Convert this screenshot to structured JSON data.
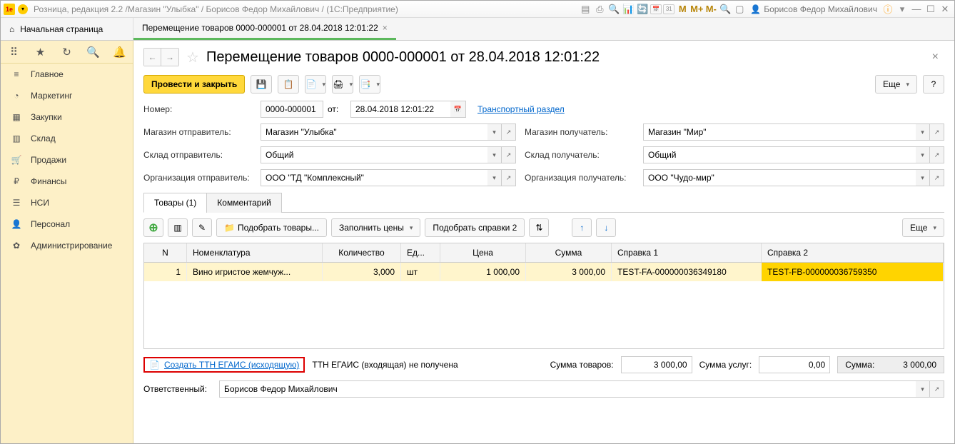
{
  "titlebar": {
    "title": "Розница, редакция 2.2 /Магазин \"Улыбка\" / Борисов Федор Михайлович / (1С:Предприятие)",
    "user": "Борисов Федор Михайлович"
  },
  "tabs": {
    "home": "Начальная страница",
    "doc": "Перемещение товаров 0000-000001 от 28.04.2018 12:01:22"
  },
  "sidebar": {
    "items": [
      {
        "label": "Главное",
        "icon": "≡"
      },
      {
        "label": "Маркетинг",
        "icon": "◔"
      },
      {
        "label": "Закупки",
        "icon": "▦"
      },
      {
        "label": "Склад",
        "icon": "▥"
      },
      {
        "label": "Продажи",
        "icon": "🛒"
      },
      {
        "label": "Финансы",
        "icon": "₽"
      },
      {
        "label": "НСИ",
        "icon": "☰"
      },
      {
        "label": "Персонал",
        "icon": "👤"
      },
      {
        "label": "Администрирование",
        "icon": "✿"
      }
    ]
  },
  "doc": {
    "title": "Перемещение товаров 0000-000001 от 28.04.2018 12:01:22",
    "post_close": "Провести и закрыть",
    "more": "Еще",
    "help": "?",
    "number_lbl": "Номер:",
    "number": "0000-000001",
    "from_lbl": "от:",
    "date": "28.04.2018 12:01:22",
    "transport_link": "Транспортный раздел",
    "store_from_lbl": "Магазин отправитель:",
    "store_from": "Магазин \"Улыбка\"",
    "store_to_lbl": "Магазин получатель:",
    "store_to": "Магазин \"Мир\"",
    "wh_from_lbl": "Склад отправитель:",
    "wh_from": "Общий",
    "wh_to_lbl": "Склад получатель:",
    "wh_to": "Общий",
    "org_from_lbl": "Организация отправитель:",
    "org_from": "ООО \"ТД \"Комплексный\"",
    "org_to_lbl": "Организация получатель:",
    "org_to": "ООО \"Чудо-мир\"",
    "tab_goods": "Товары (1)",
    "tab_comment": "Комментарий",
    "pick_goods": "Подобрать товары...",
    "fill_prices": "Заполнить цены",
    "pick_ref": "Подобрать справки 2",
    "grid": {
      "head": {
        "n": "N",
        "nom": "Номенклатура",
        "qty": "Количество",
        "unit": "Ед...",
        "price": "Цена",
        "sum": "Сумма",
        "ref1": "Справка 1",
        "ref2": "Справка 2"
      },
      "rows": [
        {
          "n": "1",
          "nom": "Вино игристое жемчуж...",
          "qty": "3,000",
          "unit": "шт",
          "price": "1 000,00",
          "sum": "3 000,00",
          "ref1": "TEST-FA-000000036349180",
          "ref2": "TEST-FB-000000036759350"
        }
      ]
    },
    "egais_link": "Создать ТТН ЕГАИС (исходящую)",
    "egais_status": "ТТН ЕГАИС (входящая) не получена",
    "sum_goods_lbl": "Сумма товаров:",
    "sum_goods": "3 000,00",
    "sum_serv_lbl": "Сумма услуг:",
    "sum_serv": "0,00",
    "total_lbl": "Сумма:",
    "total": "3 000,00",
    "resp_lbl": "Ответственный:",
    "resp": "Борисов Федор Михайлович"
  }
}
